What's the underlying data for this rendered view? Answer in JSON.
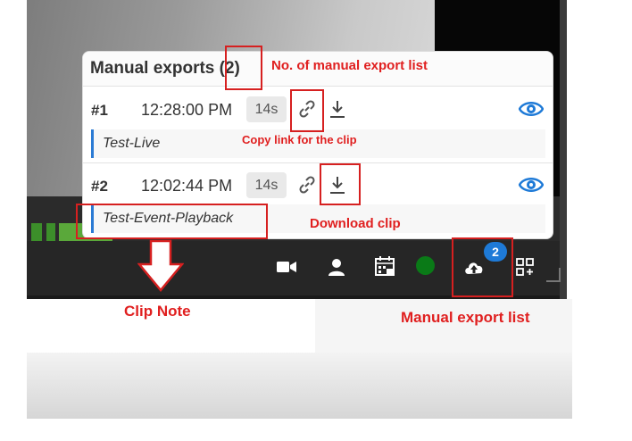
{
  "panel": {
    "title": "Manual exports",
    "count": "(2)",
    "rows": [
      {
        "num": "#1",
        "time": "12:28:00 PM",
        "duration": "14s",
        "note": "Test-Live"
      },
      {
        "num": "#2",
        "time": "12:02:44 PM",
        "duration": "14s",
        "note": "Test-Event-Playback"
      }
    ]
  },
  "toolbar": {
    "export_badge": "2",
    "icons": [
      "video-camera-icon",
      "person-icon",
      "calendar-24h-icon",
      "recording-status-dot",
      "cloud-upload-icon",
      "layout-grid-icon"
    ]
  },
  "annotations": {
    "count_label": "No. of manual export list",
    "copy_link_label": "Copy link for the clip",
    "download_label": "Download clip",
    "clip_note_label": "Clip Note",
    "export_list_label": "Manual export list"
  },
  "colors": {
    "accent": "#1e7ad7",
    "annotation": "#e01f1f",
    "recording": "#0a7a17"
  }
}
